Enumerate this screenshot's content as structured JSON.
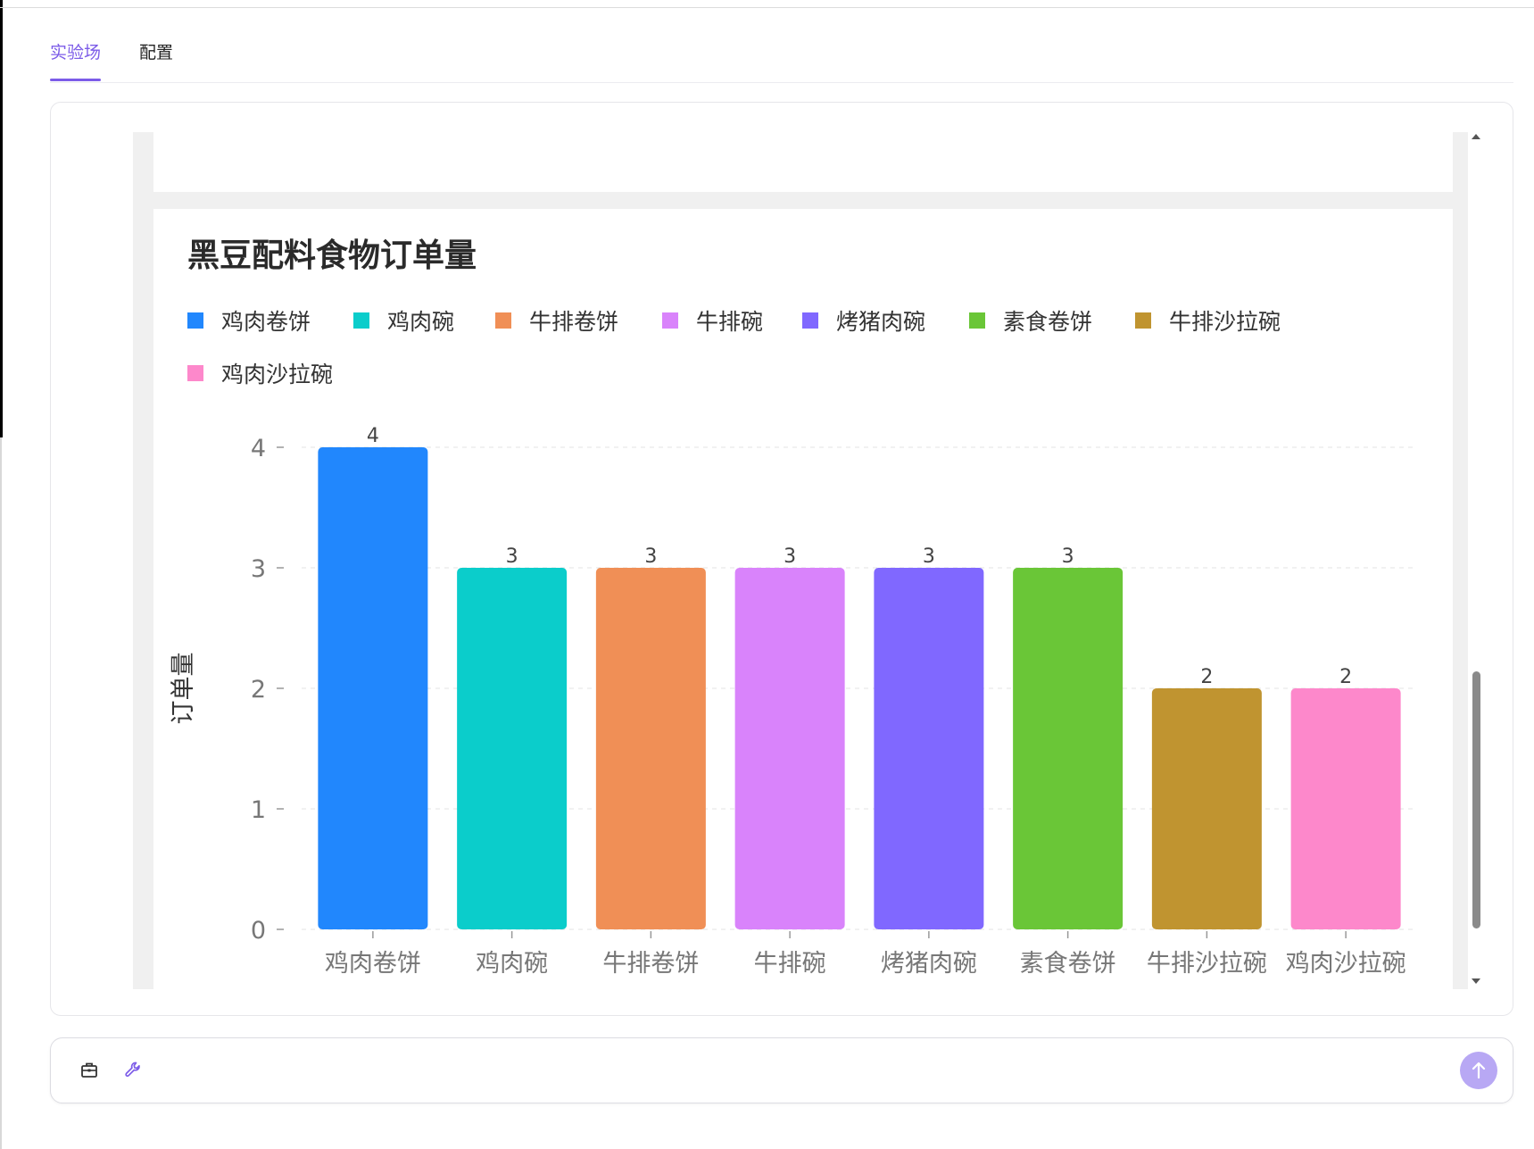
{
  "tabs": [
    {
      "label": "实验场",
      "active": true
    },
    {
      "label": "配置",
      "active": false
    }
  ],
  "colors": {
    "accent": "#7c5ce8",
    "send_button": "#b8a8f4"
  },
  "icons": {
    "tool_1": "toolbox-icon",
    "tool_2": "wrench-icon",
    "send": "arrow-up-icon"
  },
  "chart_data": {
    "type": "bar",
    "title": "黑豆配料食物订单量",
    "xlabel": "",
    "ylabel": "订单量",
    "categories": [
      "鸡肉卷饼",
      "鸡肉碗",
      "牛排卷饼",
      "牛排碗",
      "烤猪肉碗",
      "素食卷饼",
      "牛排沙拉碗",
      "鸡肉沙拉碗"
    ],
    "values": [
      4,
      3,
      3,
      3,
      3,
      3,
      2,
      2
    ],
    "colors": [
      "#2187fd",
      "#0bcdcb",
      "#f08f56",
      "#d983fb",
      "#8068ff",
      "#6ac637",
      "#c09430",
      "#fd88cb"
    ],
    "yticks": [
      0,
      1,
      2,
      3,
      4
    ],
    "ylim": [
      0,
      4
    ],
    "grid": true,
    "legend_position": "top-left",
    "data_labels": true
  }
}
